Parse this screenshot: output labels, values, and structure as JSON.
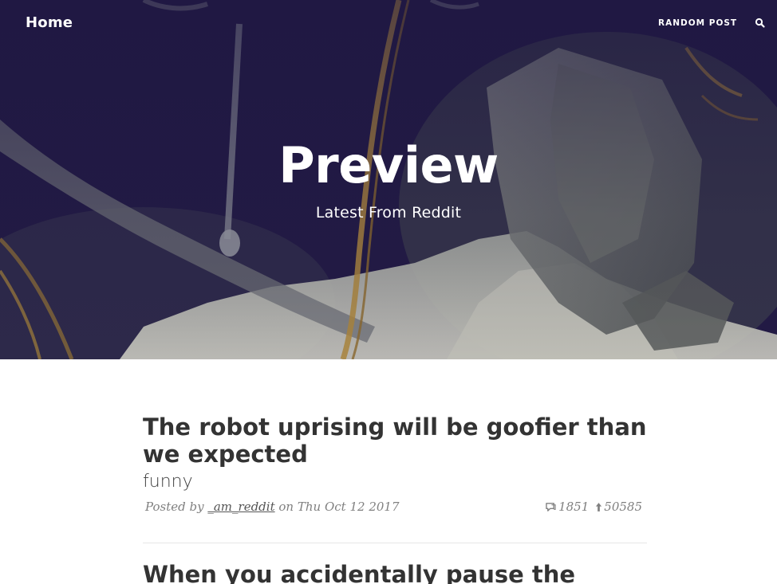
{
  "nav": {
    "home_label": "Home",
    "random_post_label": "RANDOM POST",
    "search_icon": "search-icon"
  },
  "hero": {
    "title": "Preview",
    "subtitle": "Latest From Reddit"
  },
  "posts": [
    {
      "title": "The robot uprising will be goofier than we expected",
      "subreddit": "funny",
      "posted_by_prefix": "Posted by",
      "author": "_am_reddit",
      "date_prefix": "on",
      "date": "Thu Oct 12 2017",
      "comments_icon": "comments-icon",
      "comments": "1851",
      "upvotes_icon": "upvote-arrow-icon",
      "upvotes": "50585"
    },
    {
      "title": "When you accidentally pause the"
    }
  ]
}
